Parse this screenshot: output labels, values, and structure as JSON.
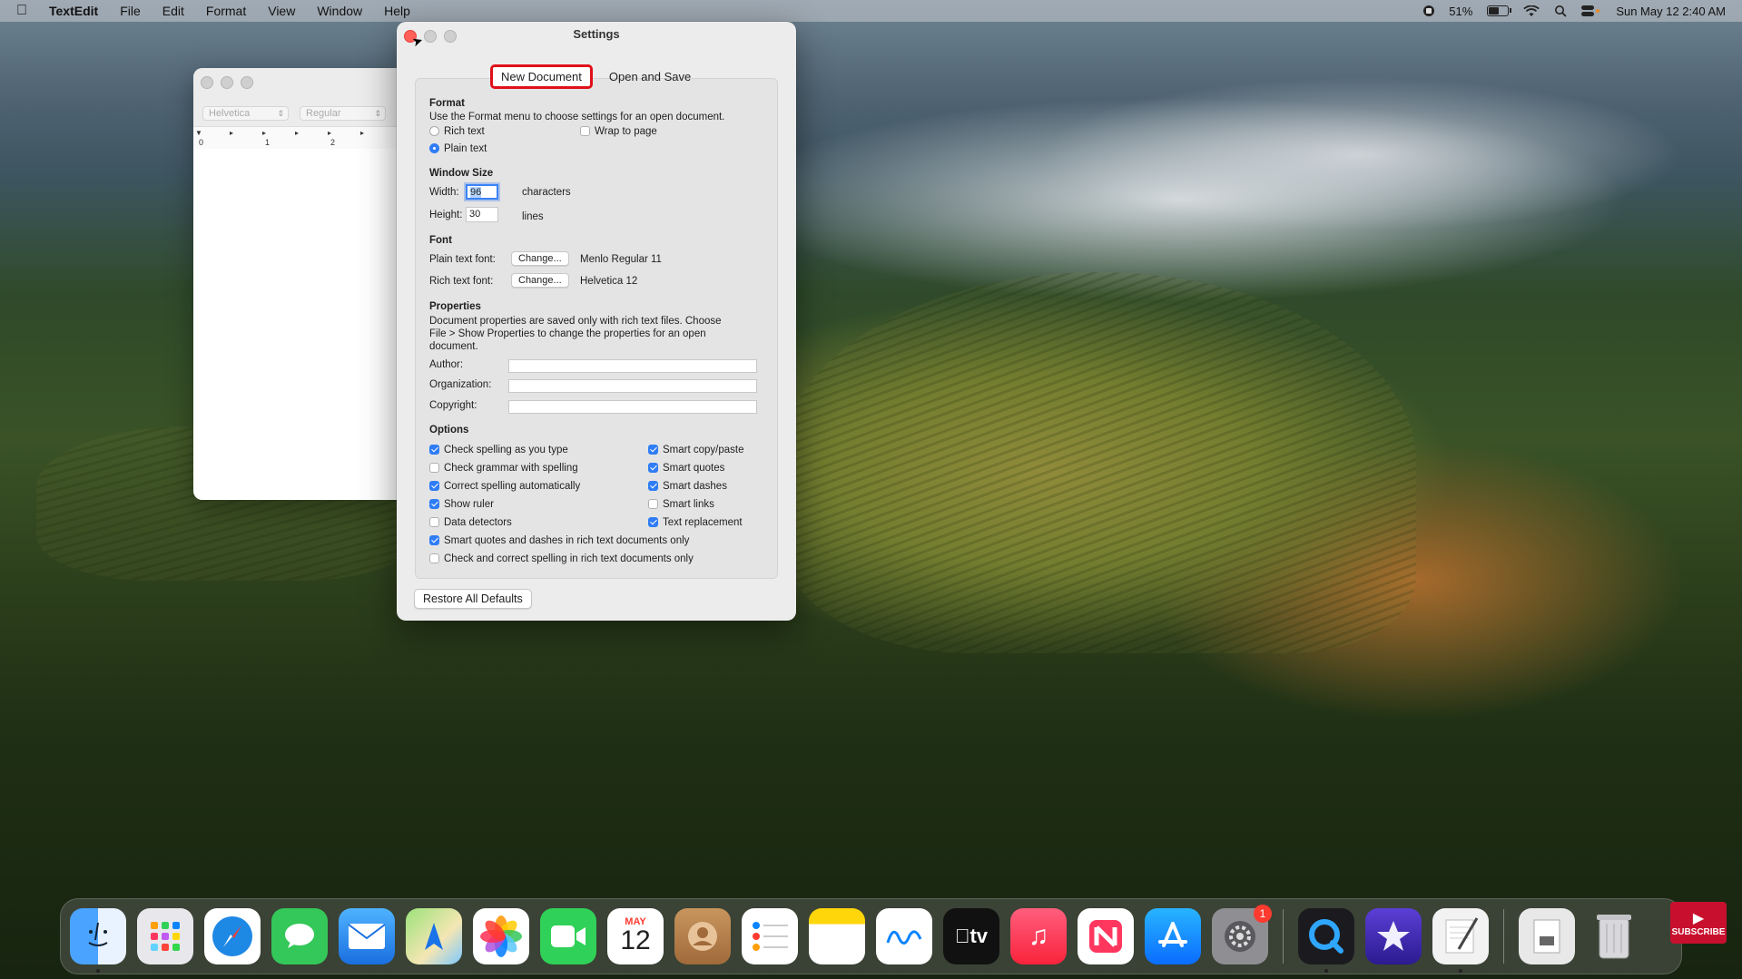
{
  "menubar": {
    "app_name": "TextEdit",
    "menus": [
      "File",
      "Edit",
      "Format",
      "View",
      "Window",
      "Help"
    ],
    "battery_percent": "51%",
    "datetime": "Sun May 12  2:40 AM"
  },
  "doc_window": {
    "font_family": "Helvetica",
    "font_style": "Regular",
    "ruler_numbers": [
      "0",
      "1",
      "2"
    ]
  },
  "settings": {
    "title": "Settings",
    "tabs": [
      "New Document",
      "Open and Save"
    ],
    "format": {
      "heading": "Format",
      "description": "Use the Format menu to choose settings for an open document.",
      "rich_text": "Rich text",
      "plain_text": "Plain text",
      "wrap_to_page": "Wrap to page"
    },
    "window_size": {
      "heading": "Window Size",
      "width_label": "Width:",
      "width_value": "96",
      "width_unit": "characters",
      "height_label": "Height:",
      "height_value": "30",
      "height_unit": "lines"
    },
    "font": {
      "heading": "Font",
      "plain_label": "Plain text font:",
      "plain_change": "Change...",
      "plain_value": "Menlo Regular 11",
      "rich_label": "Rich text font:",
      "rich_change": "Change...",
      "rich_value": "Helvetica 12"
    },
    "properties": {
      "heading": "Properties",
      "description_line1": "Document properties are saved only with rich text files. Choose",
      "description_line2": "File > Show Properties to change the properties for an open",
      "description_line3": "document.",
      "author_label": "Author:",
      "organization_label": "Organization:",
      "copyright_label": "Copyright:"
    },
    "options": {
      "heading": "Options",
      "left": [
        {
          "label": "Check spelling as you type",
          "checked": true
        },
        {
          "label": "Check grammar with spelling",
          "checked": false
        },
        {
          "label": "Correct spelling automatically",
          "checked": true
        },
        {
          "label": "Show ruler",
          "checked": true
        },
        {
          "label": "Data detectors",
          "checked": false
        }
      ],
      "right": [
        {
          "label": "Smart copy/paste",
          "checked": true
        },
        {
          "label": "Smart quotes",
          "checked": true
        },
        {
          "label": "Smart dashes",
          "checked": true
        },
        {
          "label": "Smart links",
          "checked": false
        },
        {
          "label": "Text replacement",
          "checked": true
        }
      ],
      "rich_smart": "Smart quotes and dashes in rich text documents only",
      "rich_spelling": "Check and correct spelling in rich text documents only"
    },
    "restore_button": "Restore All Defaults"
  },
  "dock": {
    "calendar_month": "MAY",
    "calendar_day": "12",
    "settings_badge": "1"
  },
  "subscribe_label": "SUBSCRIBE"
}
